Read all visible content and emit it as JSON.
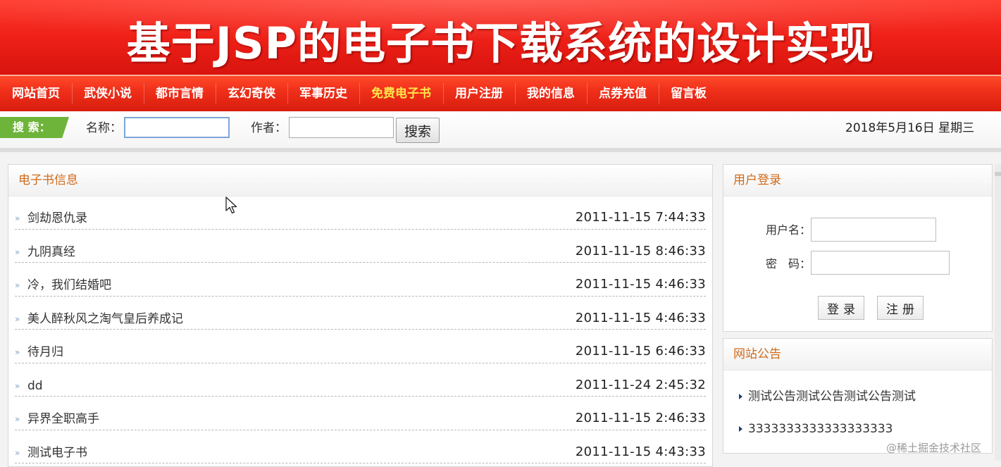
{
  "banner": {
    "title": "基于JSP的电子书下载系统的设计实现"
  },
  "nav": {
    "items": [
      {
        "label": "网站首页",
        "active": false
      },
      {
        "label": "武侠小说",
        "active": false
      },
      {
        "label": "都市言情",
        "active": false
      },
      {
        "label": "玄幻奇侠",
        "active": false
      },
      {
        "label": "军事历史",
        "active": false
      },
      {
        "label": "免费电子书",
        "active": true
      },
      {
        "label": "用户注册",
        "active": false
      },
      {
        "label": "我的信息",
        "active": false
      },
      {
        "label": "点券充值",
        "active": false
      },
      {
        "label": "留言板",
        "active": false
      }
    ]
  },
  "search": {
    "tag": "搜 索：",
    "name_label": "名称：",
    "name_value": "",
    "author_label": "作者：",
    "author_value": "",
    "button_label": "搜索",
    "date": "2018年5月16日 星期三"
  },
  "books": {
    "title": "电子书信息",
    "items": [
      {
        "title": "剑劫恩仇录",
        "time": "2011-11-15 7:44:33"
      },
      {
        "title": "九阴真经",
        "time": "2011-11-15 8:46:33"
      },
      {
        "title": "冷，我们结婚吧",
        "time": "2011-11-15 4:46:33"
      },
      {
        "title": "美人醉秋风之淘气皇后养成记",
        "time": "2011-11-15 4:46:33"
      },
      {
        "title": "待月归",
        "time": "2011-11-15 6:46:33"
      },
      {
        "title": "dd",
        "time": "2011-11-24 2:45:32"
      },
      {
        "title": "异界全职高手",
        "time": "2011-11-15 2:46:33"
      },
      {
        "title": "测试电子书",
        "time": "2011-11-15 4:43:33"
      }
    ]
  },
  "login": {
    "title": "用户登录",
    "username_label": "用户名：",
    "username_value": "",
    "password_label": "密　码：",
    "password_value": "",
    "login_button": "登录",
    "register_button": "注册"
  },
  "notice": {
    "title": "网站公告",
    "items": [
      "测试公告测试公告测试公告测试",
      "3333333333333333333"
    ]
  },
  "watermark": {
    "text": "@稀土掘金技术社区"
  },
  "colors": {
    "banner_red": "#f02219",
    "nav_active": "#ffe54a",
    "search_tag_green": "#6fb43a",
    "panel_title_orange": "#d06a1a"
  }
}
